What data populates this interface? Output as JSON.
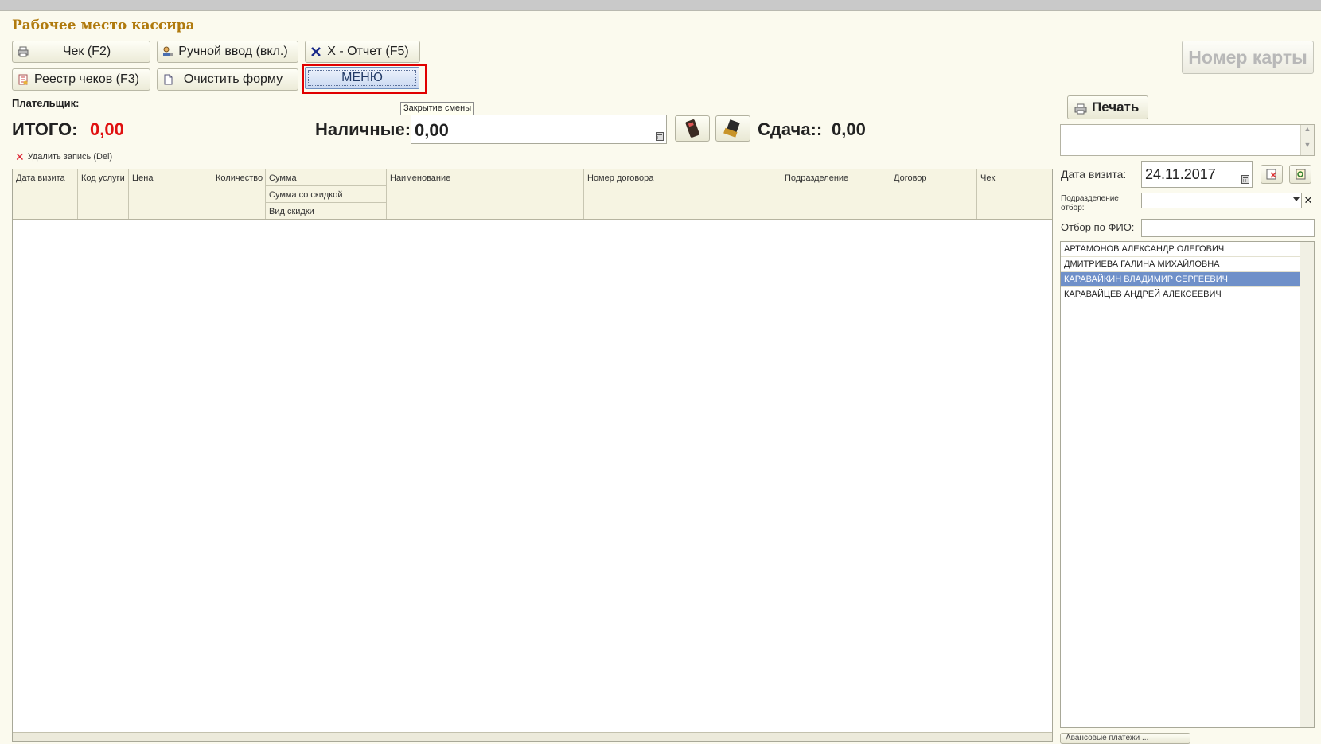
{
  "window": {
    "title": "Рабочее место кассира"
  },
  "toolbar": {
    "check_label": "Чек (F2)",
    "manual_label": "Ручной ввод (вкл.)",
    "xreport_label": "X - Отчет (F5)",
    "registry_label": "Реестр чеков (F3)",
    "clear_label": "Очистить форму",
    "menu_label": "МЕНЮ",
    "menu_tooltip": "Закрытие смены"
  },
  "payer": {
    "label": "Плательщик:"
  },
  "totals": {
    "itogo_label": "ИТОГО:",
    "itogo_value": "0,00",
    "cash_label": "Наличные:",
    "cash_value": "0,00",
    "change_label": "Сдача::",
    "change_value": "0,00"
  },
  "delete_link": "Удалить запись (Del)",
  "grid": {
    "columns": {
      "visit_date": "Дата визита",
      "service_code": "Код услуги",
      "price": "Цена",
      "quantity": "Количество",
      "sum": "Сумма",
      "sum_discount": "Сумма со скидкой",
      "discount_type": "Вид скидки",
      "name": "Наименование",
      "contract_number": "Номер договора",
      "department": "Подразделение",
      "contract": "Договор",
      "check": "Чек"
    },
    "rows": []
  },
  "right_panel": {
    "card_button": "Номер карты",
    "print_button": "Печать",
    "visit_date_label": "Дата визита:",
    "visit_date_value": "24.11.2017",
    "dept_label": "Подразделение отбор:",
    "fio_label": "Отбор по ФИО:",
    "patients": [
      "АРТАМОНОВ АЛЕКСАНДР ОЛЕГОВИЧ",
      "ДМИТРИЕВА ГАЛИНА МИХАЙЛОВНА",
      "КАРАВАЙКИН ВЛАДИМИР СЕРГЕЕВИЧ",
      "КАРАВАЙЦЕВ АНДРЕЙ АЛЕКСЕЕВИЧ"
    ],
    "selected_index": 2,
    "bottom_button": "Авансовые платежи ..."
  },
  "colors": {
    "accent": "#e01010",
    "title": "#b07a0d",
    "selection": "#6f90c9",
    "highlight_frame": "#e00000"
  }
}
